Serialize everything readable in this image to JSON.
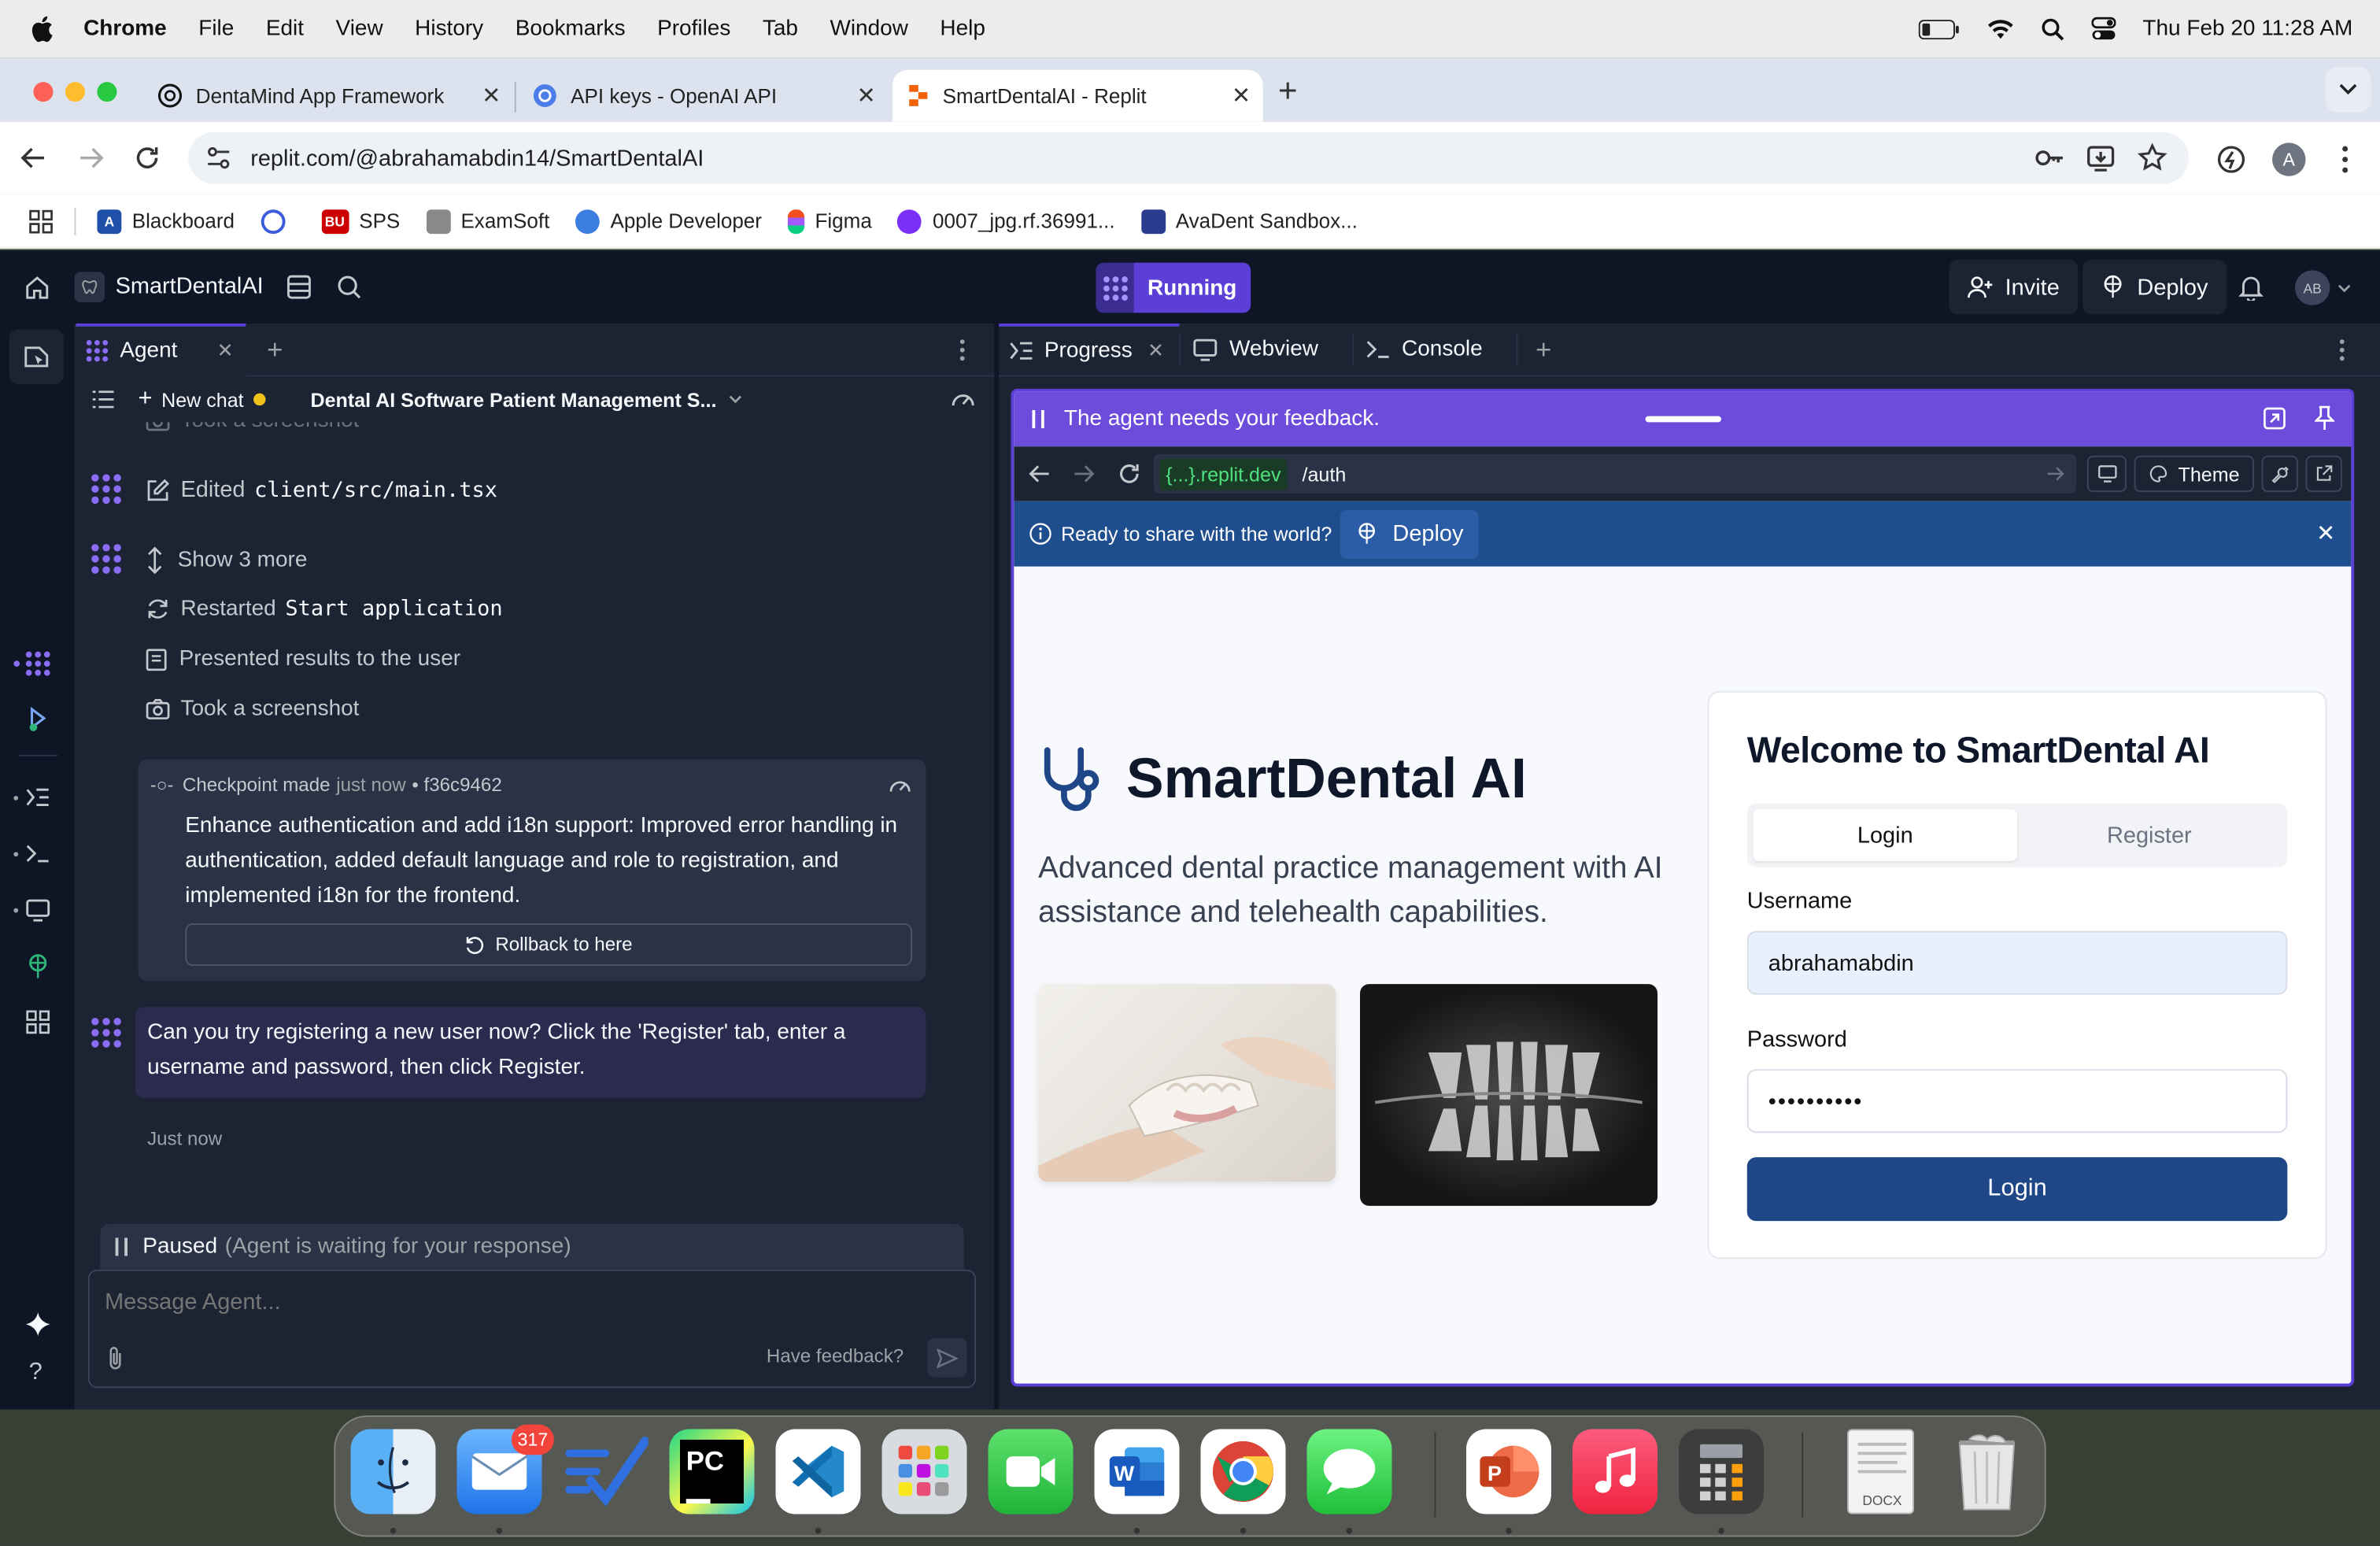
{
  "menubar": {
    "app": "Chrome",
    "items": [
      "File",
      "Edit",
      "View",
      "History",
      "Bookmarks",
      "Profiles",
      "Tab",
      "Window",
      "Help"
    ],
    "datetime": "Thu Feb 20  11:28 AM"
  },
  "browser": {
    "tabs": [
      {
        "title": "DentaMind App Framework"
      },
      {
        "title": "API keys - OpenAI API"
      },
      {
        "title": "SmartDentalAI - Replit"
      }
    ],
    "url": "replit.com/@abrahamabdin14/SmartDentalAI",
    "profile_initial": "A",
    "bookmarks": [
      "Blackboard",
      "SPS",
      "ExamSoft",
      "Apple Developer",
      "Figma",
      "0007_jpg.rf.36991...",
      "AvaDent Sandbox..."
    ]
  },
  "replit": {
    "project_name": "SmartDentalAI",
    "run_status": "Running",
    "invite_label": "Invite",
    "deploy_label": "Deploy",
    "avatar_initials": "AB",
    "left_tab": "Agent",
    "new_chat_label": "New chat",
    "chat_title": "Dental AI Software Patient Management S...",
    "partial_activity": "Took a screenshot",
    "edited_label": "Edited",
    "edited_file": "client/src/main.tsx",
    "show_more": "Show 3 more",
    "restarted_label": "Restarted",
    "restarted_target": "Start application",
    "presented": "Presented results to the user",
    "took_screenshot": "Took a screenshot",
    "checkpoint": {
      "label": "Checkpoint made",
      "time": "just now",
      "hash": "• f36c9462",
      "description": "Enhance authentication and add i18n support: Improved error handling in authentication, added default language and role to registration, and implemented i18n for the frontend.",
      "rollback_label": "Rollback to here"
    },
    "agent_message": "Can you try registering a new user now? Click the 'Register' tab, enter a username and password, then click Register.",
    "message_time": "Just now",
    "paused_label": "Paused",
    "paused_detail": "(Agent is waiting for your response)",
    "input_placeholder": "Message Agent...",
    "feedback_link": "Have feedback?",
    "right_tabs": [
      "Progress",
      "Webview",
      "Console"
    ],
    "feedback_bar": "The agent needs your feedback.",
    "preview_host": "{...}.replit.dev",
    "preview_path": "/auth",
    "theme_label": "Theme",
    "banner_text": "Ready to share with the world?",
    "banner_deploy": "Deploy"
  },
  "app": {
    "brand": "SmartDental AI",
    "tagline": "Advanced dental practice management with AI assistance and telehealth capabilities.",
    "card_title": "Welcome to SmartDental AI",
    "tab_login": "Login",
    "tab_register": "Register",
    "username_label": "Username",
    "username_value": "abrahamabdin",
    "password_label": "Password",
    "password_value": "••••••••••",
    "login_button": "Login"
  },
  "dock": {
    "mail_badge": "317",
    "docx_label": "DOCX"
  },
  "colors": {
    "replit_bg": "#0e1525",
    "replit_panel": "#1c2333",
    "accent_purple": "#6d4bdb",
    "app_primary": "#1f4788",
    "banner_blue": "#1f4e8f"
  }
}
